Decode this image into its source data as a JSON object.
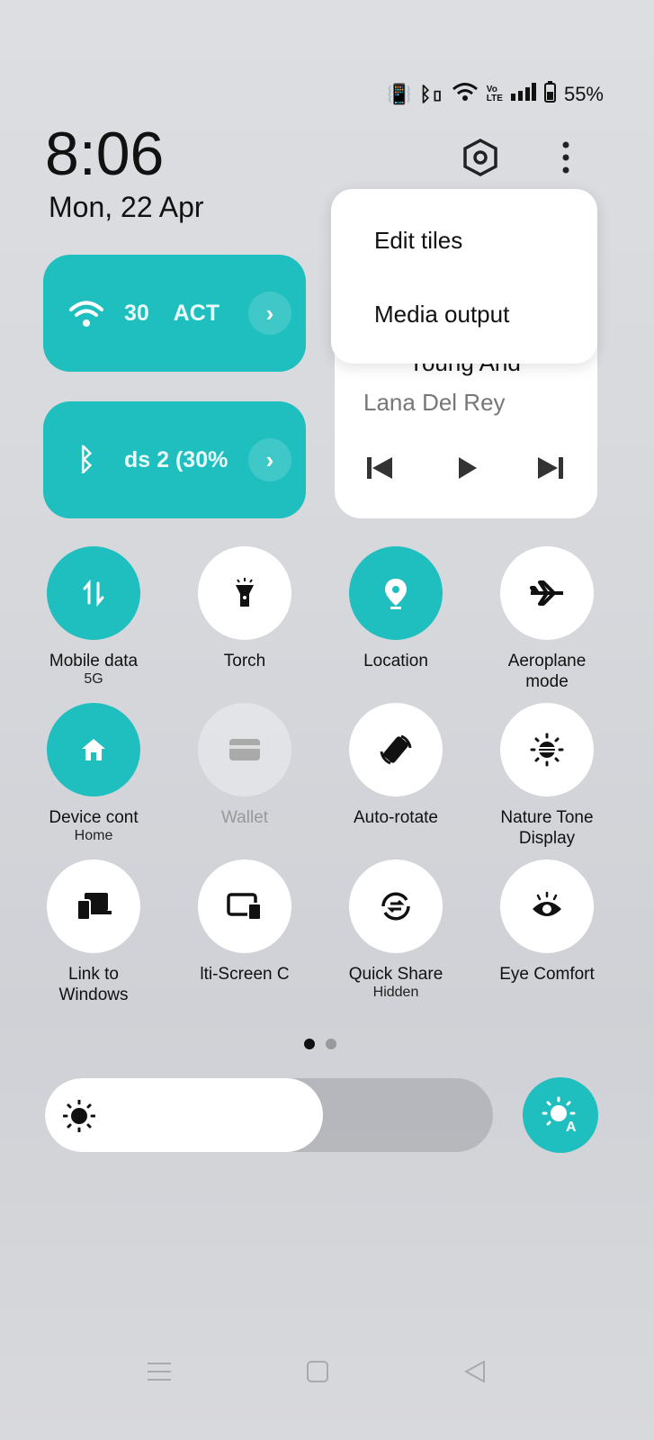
{
  "status": {
    "battery": "55%",
    "icons": [
      "vibrate-icon",
      "bluetooth-battery-icon",
      "wifi-icon",
      "volte-icon",
      "signal-icon",
      "battery-icon"
    ]
  },
  "clock": {
    "time": "8:06",
    "date": "Mon, 22 Apr"
  },
  "menu": {
    "items": [
      "Edit tiles",
      "Media output"
    ]
  },
  "wifi_tile": {
    "text": "30    ACT"
  },
  "bt_tile": {
    "text": "ds 2 (30%"
  },
  "media": {
    "title": "Young And",
    "artist": "Lana Del Rey"
  },
  "tiles": [
    {
      "label": "Mobile data",
      "sub": "5G",
      "icon": "mobile-data-icon",
      "state": "on"
    },
    {
      "label": "Torch",
      "sub": "",
      "icon": "torch-icon",
      "state": "off"
    },
    {
      "label": "Location",
      "sub": "",
      "icon": "location-icon",
      "state": "on"
    },
    {
      "label": "Aeroplane mode",
      "sub": "",
      "icon": "airplane-icon",
      "state": "off"
    },
    {
      "label": "Device cont",
      "sub": "Home",
      "icon": "home-icon",
      "state": "on"
    },
    {
      "label": "Wallet",
      "sub": "",
      "icon": "wallet-icon",
      "state": "disabled"
    },
    {
      "label": "Auto-rotate",
      "sub": "",
      "icon": "auto-rotate-icon",
      "state": "off"
    },
    {
      "label": "Nature Tone Display",
      "sub": "",
      "icon": "nature-tone-icon",
      "state": "off"
    },
    {
      "label": "Link to Windows",
      "sub": "",
      "icon": "link-to-windows-icon",
      "state": "off"
    },
    {
      "label": "lti-Screen C",
      "sub": "",
      "icon": "multi-screen-icon",
      "state": "off"
    },
    {
      "label": "Quick Share",
      "sub": "Hidden",
      "icon": "quick-share-icon",
      "state": "off"
    },
    {
      "label": "Eye Comfort",
      "sub": "",
      "icon": "eye-icon",
      "state": "off"
    }
  ],
  "pager": {
    "pages": 2,
    "current": 1
  },
  "brightness": {
    "level_percent": 62
  },
  "colors": {
    "accent": "#1fbfbf"
  }
}
